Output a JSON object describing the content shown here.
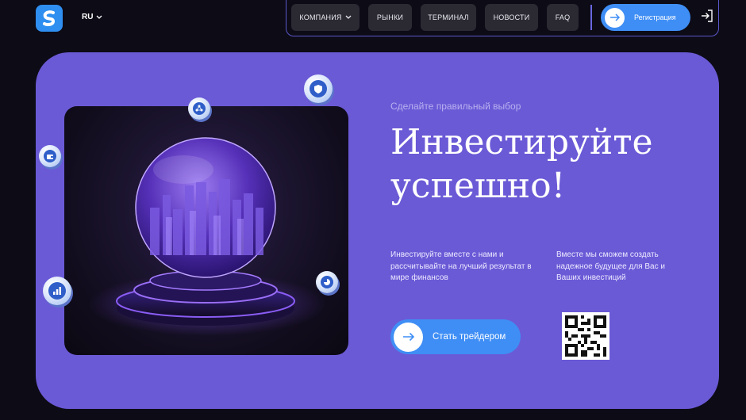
{
  "header": {
    "logo_letter": "S",
    "language": "RU",
    "nav": [
      {
        "label": "КОМПАНИЯ",
        "has_dropdown": true
      },
      {
        "label": "РЫНКИ"
      },
      {
        "label": "ТЕРМИНАЛ"
      },
      {
        "label": "НОВОСТИ"
      },
      {
        "label": "FAQ"
      }
    ],
    "register_label": "Регистрация"
  },
  "hero": {
    "subtitle": "Сделайте правильный выбор",
    "headline_line1": "Инвестируйте",
    "headline_line2": "успешно!",
    "desc_left": "Инвестируйте вместе с нами и рассчитывайте на лучший результат в мире финансов",
    "desc_right": "Вместе мы сможем создать надежное будущее для Вас и Ваших инвестиций",
    "cta_label": "Стать трейдером"
  },
  "colors": {
    "background": "#0d0b16",
    "card": "#6a5ad6",
    "accent_blue": "#3f8ef5",
    "nav_button": "#2b2a33"
  },
  "icons": [
    "logo-icon",
    "chevron-down-icon",
    "arrow-right-icon",
    "login-icon",
    "qr-code",
    "crystal-ball-city-image",
    "shield-coin-icon",
    "network-coin-icon",
    "wallet-coin-icon",
    "chart-coin-icon",
    "pie-coin-icon"
  ]
}
